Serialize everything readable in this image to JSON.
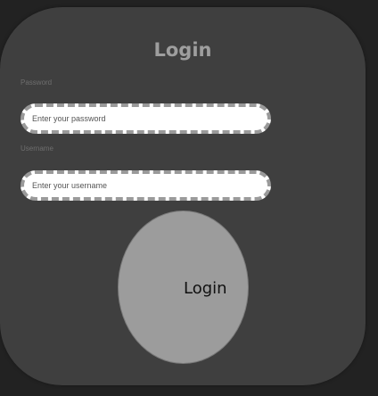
{
  "form": {
    "title": "Login",
    "password_label": "Password",
    "password_placeholder": "Enter your password",
    "username_label": "Username",
    "username_placeholder": "Enter your username",
    "submit_label": "Login"
  },
  "colors": {
    "background": "#222222",
    "card": "#3f3f3f",
    "button": "#9c9c9c",
    "title": "#9e9e9e"
  }
}
